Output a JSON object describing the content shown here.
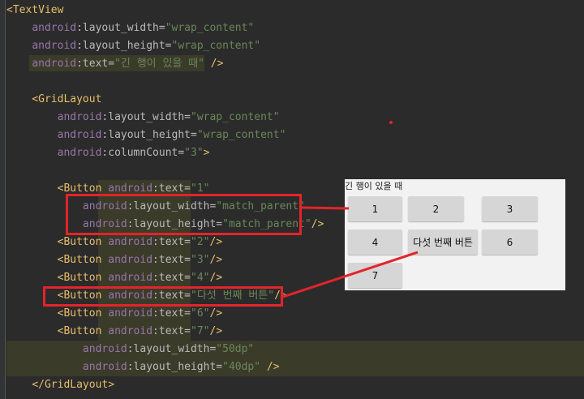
{
  "code": {
    "lines": [
      {
        "pre": "",
        "tag": "<TextView",
        "ns": "",
        "attr": "",
        "str": "",
        "post": ""
      },
      {
        "pre": "    ",
        "tag": "",
        "ns": "android",
        "attr": ":layout_width=",
        "str": "\"wrap_content\"",
        "post": ""
      },
      {
        "pre": "    ",
        "tag": "",
        "ns": "android",
        "attr": ":layout_height=",
        "str": "\"wrap_content\"",
        "post": ""
      },
      {
        "pre": "    ",
        "tag": "",
        "ns": "android",
        "attr": ":text=",
        "str": "\"긴 행이 있을 때\"",
        "post": " />"
      },
      {
        "pre": "",
        "tag": "",
        "ns": "",
        "attr": "",
        "str": "",
        "post": ""
      },
      {
        "pre": "    ",
        "tag": "<GridLayout",
        "ns": "",
        "attr": "",
        "str": "",
        "post": ""
      },
      {
        "pre": "        ",
        "tag": "",
        "ns": "android",
        "attr": ":layout_width=",
        "str": "\"wrap_content\"",
        "post": ""
      },
      {
        "pre": "        ",
        "tag": "",
        "ns": "android",
        "attr": ":layout_height=",
        "str": "\"wrap_content\"",
        "post": ""
      },
      {
        "pre": "        ",
        "tag": "",
        "ns": "android",
        "attr": ":columnCount=",
        "str": "\"3\"",
        "post": ">"
      },
      {
        "pre": "",
        "tag": "",
        "ns": "",
        "attr": "",
        "str": "",
        "post": ""
      },
      {
        "pre": "        ",
        "tag": "<Button",
        "ns": " android",
        "attr": ":text=",
        "str": "\"1\"",
        "post": ""
      },
      {
        "pre": "            ",
        "tag": "",
        "ns": "android",
        "attr": ":layout_width=",
        "str": "\"match_parent\"",
        "post": ""
      },
      {
        "pre": "            ",
        "tag": "",
        "ns": "android",
        "attr": ":layout_height=",
        "str": "\"match_parent\"",
        "post": "/>"
      },
      {
        "pre": "        ",
        "tag": "<Button",
        "ns": " android",
        "attr": ":text=",
        "str": "\"2\"",
        "post": "/>"
      },
      {
        "pre": "        ",
        "tag": "<Button",
        "ns": " android",
        "attr": ":text=",
        "str": "\"3\"",
        "post": "/>"
      },
      {
        "pre": "        ",
        "tag": "<Button",
        "ns": " android",
        "attr": ":text=",
        "str": "\"4\"",
        "post": "/>"
      },
      {
        "pre": "        ",
        "tag": "<Button",
        "ns": " android",
        "attr": ":text=",
        "str": "\"다섯 번째 버튼\"",
        "post": "/>"
      },
      {
        "pre": "        ",
        "tag": "<Button",
        "ns": " android",
        "attr": ":text=",
        "str": "\"6\"",
        "post": "/>"
      },
      {
        "pre": "        ",
        "tag": "<Button",
        "ns": " android",
        "attr": ":text=",
        "str": "\"7\"",
        "post": "/>"
      },
      {
        "pre": "            ",
        "tag": "",
        "ns": "android",
        "attr": ":layout_width=",
        "str": "\"50dp\"",
        "post": ""
      },
      {
        "pre": "            ",
        "tag": "",
        "ns": "android",
        "attr": ":layout_height=",
        "str": "\"40dp\"",
        "post": " />"
      },
      {
        "pre": "    ",
        "tag": "</GridLayout>",
        "ns": "",
        "attr": "",
        "str": "",
        "post": ""
      }
    ]
  },
  "preview": {
    "text": "긴 행이 있을 때",
    "buttons": [
      "1",
      "2",
      "3",
      "4",
      "다섯 번째 버튼",
      "6",
      "7"
    ]
  },
  "colors": {
    "editor_bg": "#2b2b2b",
    "tag": "#e8bf6a",
    "namespace": "#9876aa",
    "string": "#6a8759",
    "annotation": "#e3242b"
  }
}
